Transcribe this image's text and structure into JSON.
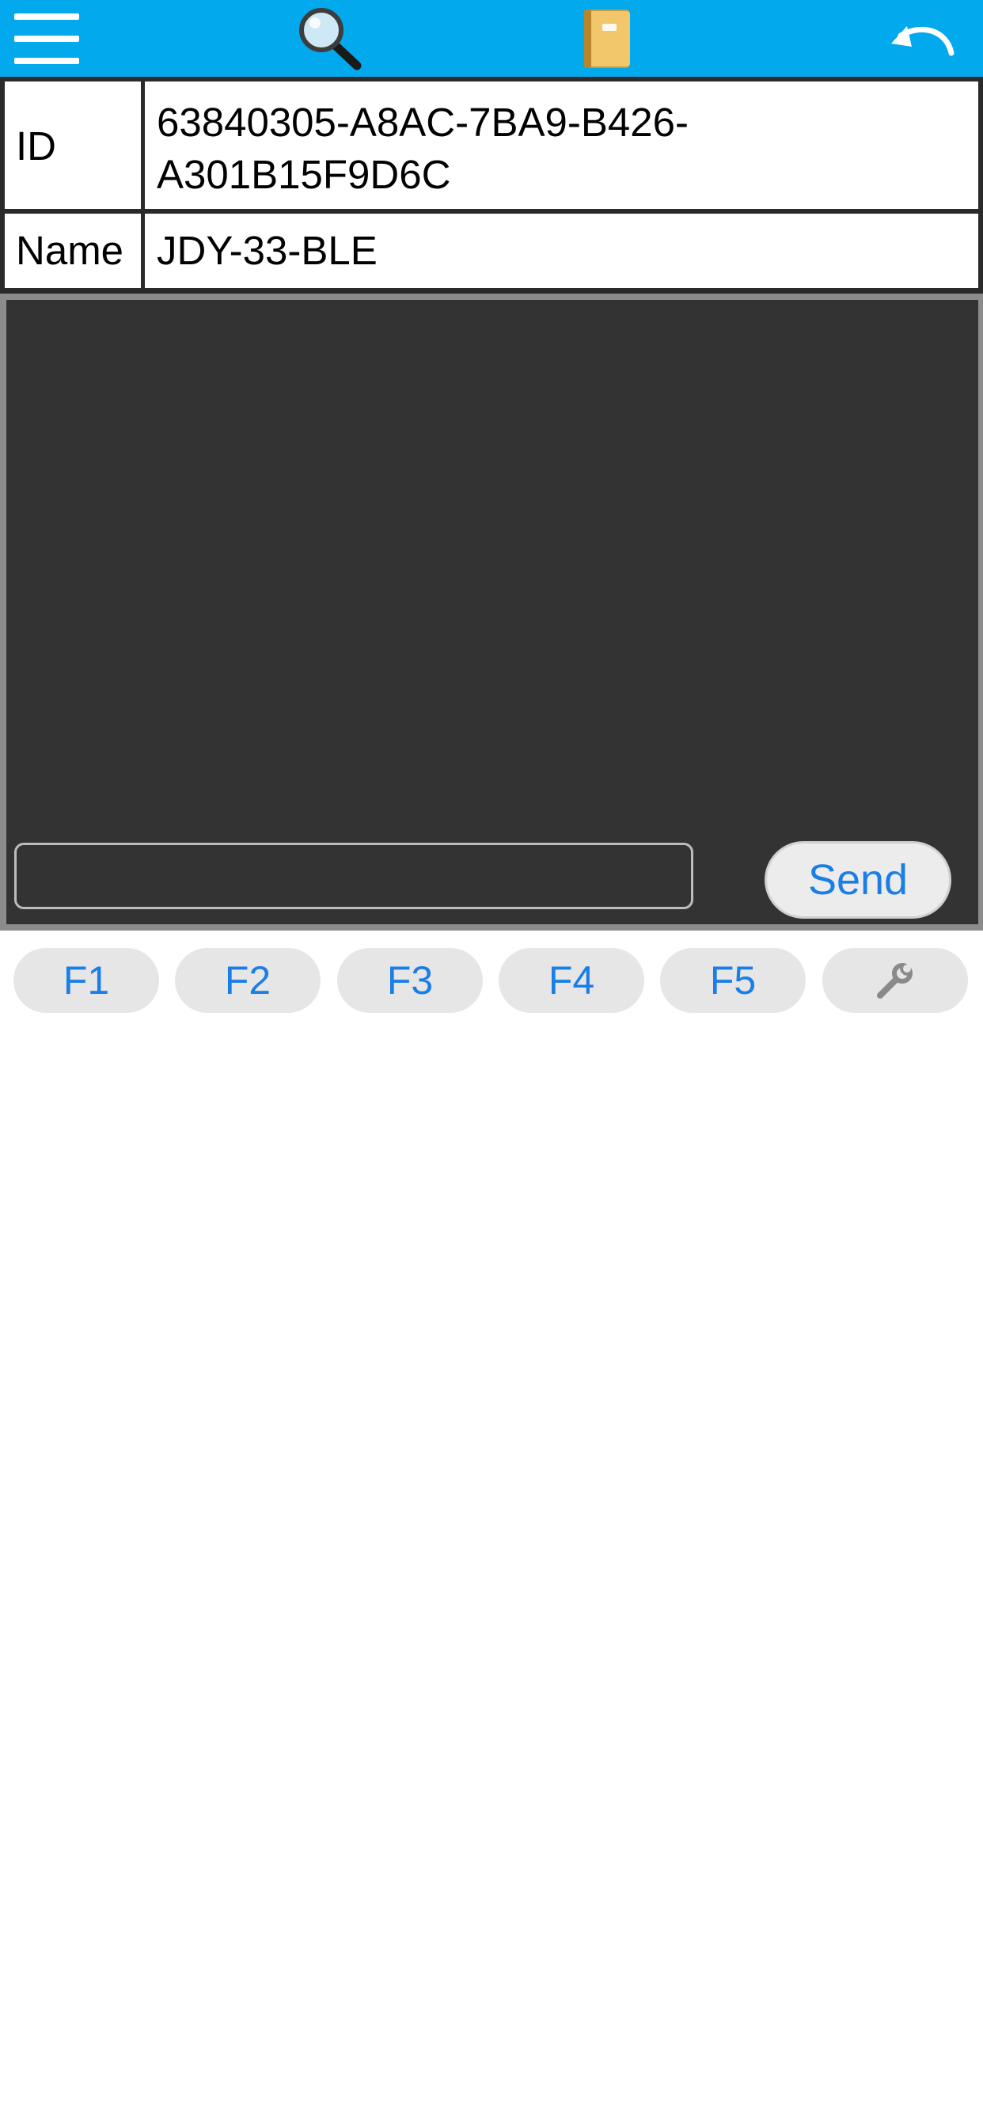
{
  "toolbar": {
    "icons": [
      "menu-icon",
      "search-icon",
      "book-icon",
      "undo-icon"
    ],
    "background": "#02a9ec"
  },
  "device": {
    "id_label": "ID",
    "id_value_line1": "63840305-A8AC-7BA9-B426-",
    "id_value_line2": "A301B15F9D6C",
    "name_label": "Name",
    "name_value": "JDY-33-BLE"
  },
  "console": {
    "input_value": "",
    "send_label": "Send"
  },
  "function_keys": {
    "f1": "F1",
    "f2": "F2",
    "f3": "F3",
    "f4": "F4",
    "f5": "F5",
    "settings_icon": "wrench-icon"
  },
  "colors": {
    "accent": "#1a7ee6",
    "console_bg": "#333333"
  }
}
